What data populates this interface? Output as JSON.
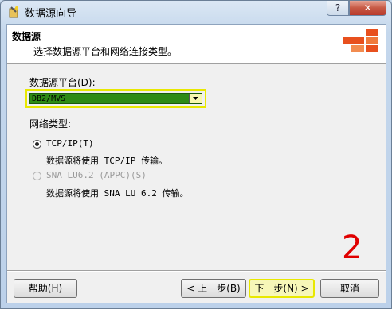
{
  "window": {
    "title": "数据源向导",
    "help_label": "?",
    "close_label": "✕"
  },
  "header": {
    "title": "数据源",
    "subtitle": "选择数据源平台和网络连接类型。"
  },
  "platform": {
    "label": "数据源平台(D):",
    "selected": "DB2/MVS"
  },
  "network": {
    "label": "网络类型:",
    "options": [
      {
        "label": "TCP/IP(T)",
        "description": "数据源将使用 TCP/IP 传输。",
        "selected": true,
        "enabled": true
      },
      {
        "label": "SNA LU6.2 (APPC)(S)",
        "description": "数据源将使用 SNA LU 6.2 传输。",
        "selected": false,
        "enabled": false
      }
    ]
  },
  "annotation": "2",
  "buttons": {
    "help": "帮助(H)",
    "back": "< 上一步(B)",
    "next": "下一步(N) >",
    "cancel": "取消"
  },
  "colors": {
    "annotation": "#e00000",
    "highlight_border": "#e8e800",
    "logo_orange": "#e8501e"
  },
  "icons": {
    "app": "wizard-icon",
    "logo": "wizard-logo",
    "dropdown": "chevron-down-icon"
  }
}
